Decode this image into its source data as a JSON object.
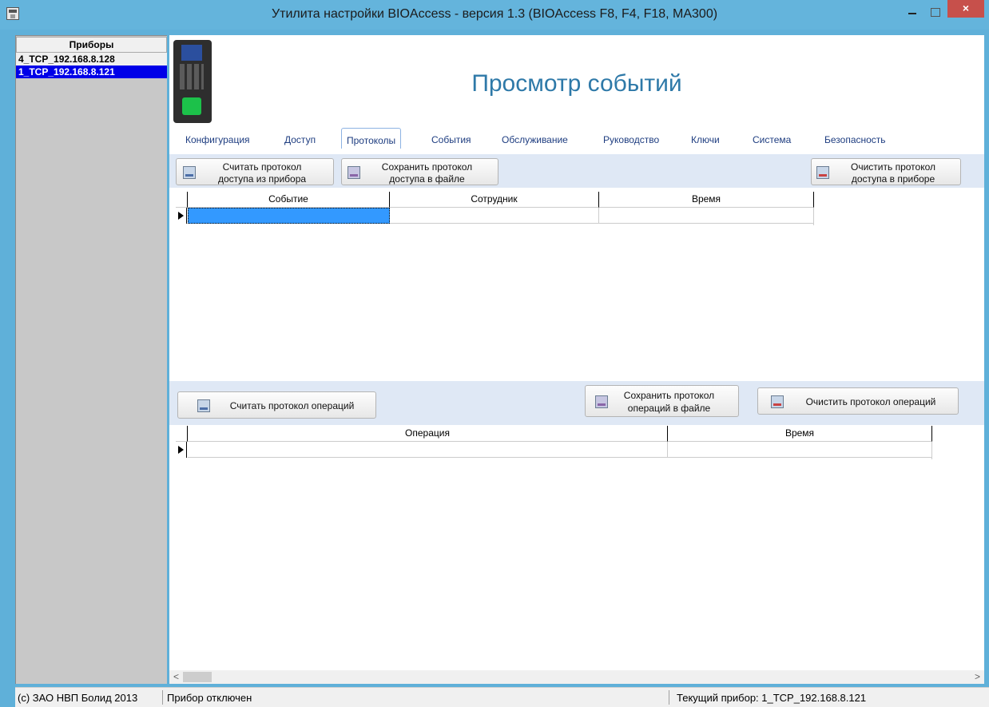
{
  "window": {
    "title": "Утилита настройки BIOAccess - версия 1.3 (BIOAccess F8, F4, F18, MA300)",
    "close_glyph": "×"
  },
  "devices_panel": {
    "header": "Приборы",
    "items": [
      {
        "label": "4_TCP_192.168.8.128",
        "selected": false
      },
      {
        "label": "1_TCP_192.168.8.121",
        "selected": true
      }
    ]
  },
  "page": {
    "heading": "Просмотр событий"
  },
  "tabs": [
    {
      "label": "Конфигурация",
      "active": false
    },
    {
      "label": "Доступ",
      "active": false
    },
    {
      "label": "Протоколы",
      "active": true
    },
    {
      "label": "События",
      "active": false
    },
    {
      "label": "Обслуживание",
      "active": false
    },
    {
      "label": "Руководство",
      "active": false
    },
    {
      "label": "Ключи",
      "active": false
    },
    {
      "label": "Система",
      "active": false
    },
    {
      "label": "Безопасность",
      "active": false
    }
  ],
  "access_log": {
    "read_button": {
      "line1": "Считать протокол",
      "line2": "доступа из прибора",
      "icon": "read-log-icon"
    },
    "save_button": {
      "line1": "Сохранить протокол",
      "line2": "доступа в файле",
      "icon": "save-file-icon"
    },
    "clear_button": {
      "line1": "Очистить протокол",
      "line2": "доступа в приборе",
      "icon": "clear-log-icon"
    },
    "columns": [
      "Событие",
      "Сотрудник",
      "Время"
    ],
    "rows": [
      [
        "",
        "",
        ""
      ]
    ]
  },
  "operations_log": {
    "read_button": {
      "label": "Считать протокол операций",
      "icon": "read-log-icon"
    },
    "save_button": {
      "line1": "Сохранить протокол",
      "line2": "операций в файле",
      "icon": "save-file-icon"
    },
    "clear_button": {
      "label": "Очистить протокол операций",
      "icon": "clear-log-icon"
    },
    "columns": [
      "Операция",
      "Время"
    ],
    "rows": [
      [
        "",
        ""
      ]
    ]
  },
  "scrollbar": {
    "left_arrow": "<",
    "right_arrow": ">"
  },
  "statusbar": {
    "copyright": "(c) ЗАО НВП Болид 2013",
    "connection": "Прибор отключен",
    "current_device": "Текущий прибор: 1_TCP_192.168.8.121"
  },
  "colors": {
    "accent": "#2e79a8",
    "selection": "#3399ff",
    "selected_device": "#0000e8",
    "toolbar_band": "#dfe8f5"
  }
}
